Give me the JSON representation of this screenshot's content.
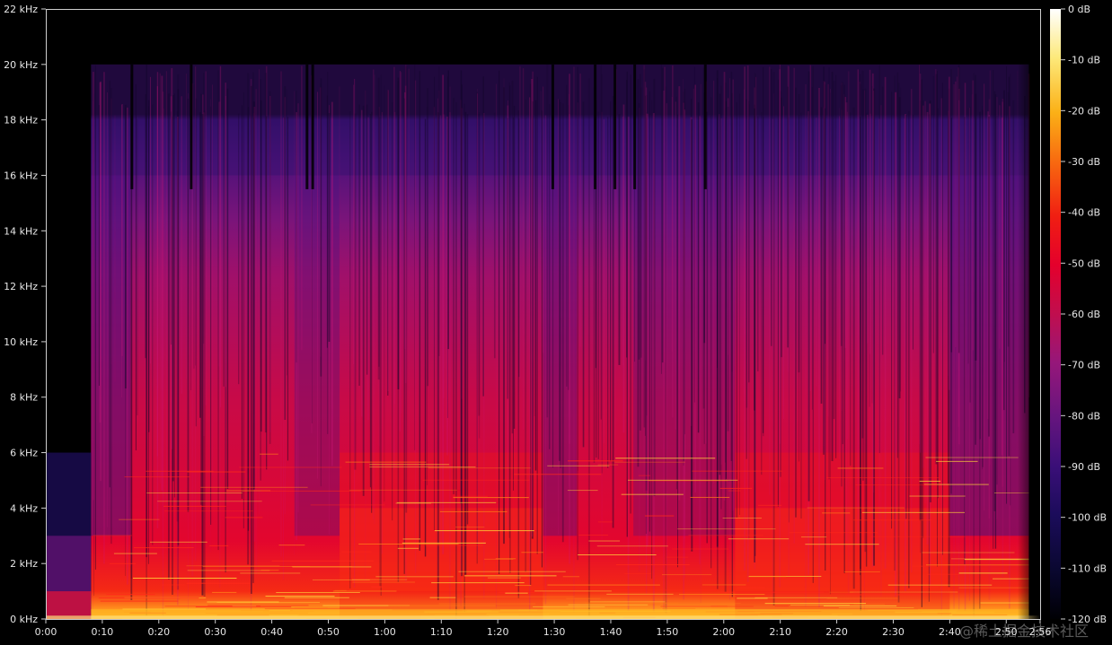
{
  "chart_data": {
    "type": "heatmap",
    "title": "",
    "xlabel": "",
    "ylabel": "",
    "x_ticks": [
      "0:00",
      "0:10",
      "0:20",
      "0:30",
      "0:40",
      "0:50",
      "1:00",
      "1:10",
      "1:20",
      "1:30",
      "1:40",
      "1:50",
      "2:00",
      "2:10",
      "2:20",
      "2:30",
      "2:40",
      "2:50",
      "2:56"
    ],
    "x_tick_seconds": [
      0,
      10,
      20,
      30,
      40,
      50,
      60,
      70,
      80,
      90,
      100,
      110,
      120,
      130,
      140,
      150,
      160,
      170,
      176
    ],
    "xlim_seconds": [
      0,
      176
    ],
    "y_ticks": [
      "0 kHz",
      "2 kHz",
      "4 kHz",
      "6 kHz",
      "8 kHz",
      "10 kHz",
      "12 kHz",
      "14 kHz",
      "16 kHz",
      "18 kHz",
      "20 kHz",
      "22 kHz"
    ],
    "y_tick_khz": [
      0,
      2,
      4,
      6,
      8,
      10,
      12,
      14,
      16,
      18,
      20,
      22
    ],
    "ylim_khz": [
      0,
      22
    ],
    "colorbar": {
      "ticks": [
        "0 dB",
        "-10 dB",
        "-20 dB",
        "-30 dB",
        "-40 dB",
        "-50 dB",
        "-60 dB",
        "-70 dB",
        "-80 dB",
        "-90 dB",
        "-100 dB",
        "-110 dB",
        "-120 dB"
      ],
      "values_db": [
        0,
        -10,
        -20,
        -30,
        -40,
        -50,
        -60,
        -70,
        -80,
        -90,
        -100,
        -110,
        -120
      ],
      "range_db": [
        -120,
        0
      ],
      "colormap": [
        "#000004",
        "#1b0c41",
        "#4a0c6b",
        "#781c6d",
        "#a52c60",
        "#cf4446",
        "#e8033a",
        "#f20a1f",
        "#fb7e21",
        "#fbb61a",
        "#fcffa4",
        "#ffffff"
      ]
    },
    "spectral_cutoff_khz": 20,
    "secondary_cutoff_khz": 16,
    "grid": false
  },
  "watermark": "@稀土掘金技术社区"
}
